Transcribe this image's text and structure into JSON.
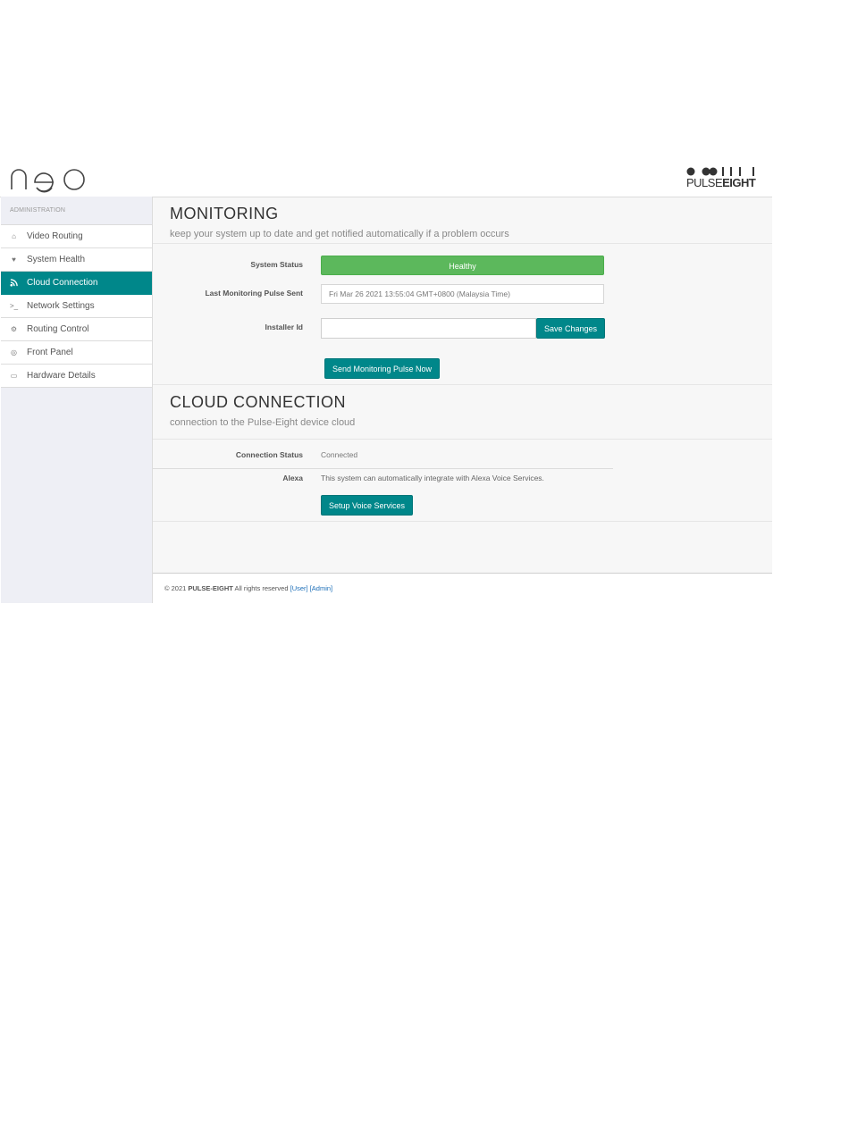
{
  "logo_text": "neo",
  "brand": {
    "part1": "PULSE",
    "part2": "EIGHT"
  },
  "sidebar": {
    "heading": "ADMINISTRATION",
    "items": [
      {
        "label": "Video Routing",
        "icon": "home-icon",
        "glyph": "⌂"
      },
      {
        "label": "System Health",
        "icon": "heart-icon",
        "glyph": "♥"
      },
      {
        "label": "Cloud Connection",
        "icon": "rss-icon",
        "glyph": "◜",
        "active": true
      },
      {
        "label": "Network Settings",
        "icon": "terminal-icon",
        "glyph": ">_"
      },
      {
        "label": "Routing Control",
        "icon": "cogs-icon",
        "glyph": "⚙"
      },
      {
        "label": "Front Panel",
        "icon": "dashboard-icon",
        "glyph": "◎"
      },
      {
        "label": "Hardware Details",
        "icon": "hdd-icon",
        "glyph": "▭"
      }
    ]
  },
  "monitoring": {
    "title": "MONITORING",
    "subtitle": "keep your system up to date and get notified automatically if a problem occurs",
    "system_status_label": "System Status",
    "system_status_value": "Healthy",
    "last_pulse_label": "Last Monitoring Pulse Sent",
    "last_pulse_value": "Fri Mar 26 2021 13:55:04 GMT+0800 (Malaysia Time)",
    "installer_label": "Installer Id",
    "installer_value": "",
    "save_button": "Save Changes",
    "send_button": "Send Monitoring Pulse Now"
  },
  "cloud": {
    "title": "CLOUD CONNECTION",
    "subtitle": "connection to the Pulse-Eight device cloud",
    "connection_label": "Connection Status",
    "connection_value": "Connected",
    "alexa_label": "Alexa",
    "alexa_text": "This system can automatically integrate with Alexa Voice Services.",
    "setup_button": "Setup Voice Services"
  },
  "footer": {
    "copyright": "© 2021",
    "company": "PULSE-EIGHT",
    "rights": "All rights reserved",
    "link_user": "[User]",
    "link_admin": "[Admin]"
  },
  "colors": {
    "accent": "#00878a",
    "healthy": "#5cb85c",
    "link": "#1d6fb8"
  }
}
